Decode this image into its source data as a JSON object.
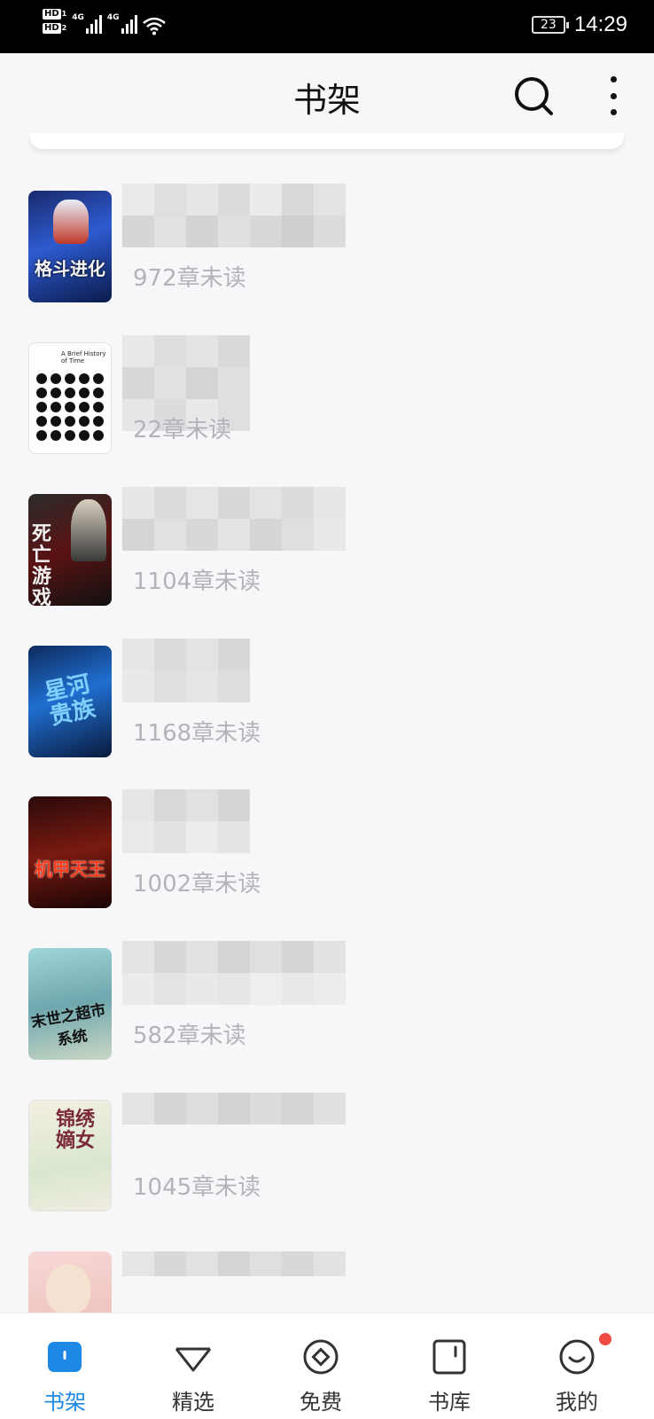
{
  "status_bar": {
    "sim1": "HD",
    "sim1_index": "1",
    "sim2": "HD",
    "sim2_index": "2",
    "network1": "4G",
    "network2": "4G",
    "battery": "23",
    "time": "14:29"
  },
  "header": {
    "title": "书架"
  },
  "books": [
    {
      "unread": "972章未读",
      "cover_text": "格斗进化"
    },
    {
      "unread": "22章未读",
      "cover_text": "A Brief History of Time"
    },
    {
      "unread": "1104章未读",
      "cover_text": "死亡游戏"
    },
    {
      "unread": "1168章未读",
      "cover_text": "星河贵族"
    },
    {
      "unread": "1002章未读",
      "cover_text": "机甲天王"
    },
    {
      "unread": "582章未读",
      "cover_text": "末世之超市系统"
    },
    {
      "unread": "1045章未读",
      "cover_text": "锦绣嫡女"
    },
    {
      "unread": "",
      "cover_text": ""
    }
  ],
  "nav": {
    "tabs": [
      {
        "label": "书架",
        "icon": "bookshelf-icon",
        "active": true
      },
      {
        "label": "精选",
        "icon": "featured-icon",
        "active": false
      },
      {
        "label": "免费",
        "icon": "free-icon",
        "active": false
      },
      {
        "label": "书库",
        "icon": "library-icon",
        "active": false
      },
      {
        "label": "我的",
        "icon": "profile-icon",
        "active": false
      }
    ]
  },
  "colors": {
    "accent": "#1e88e5",
    "badge": "#f04b43",
    "unread_text": "#b3b3b8"
  }
}
